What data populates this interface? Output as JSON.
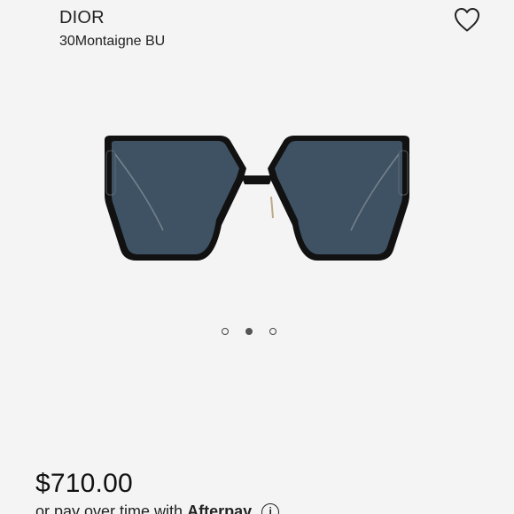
{
  "product": {
    "brand": "DIOR",
    "model": "30Montaigne BU",
    "price": "$710.00"
  },
  "favorite": {
    "icon": "heart-outline-icon"
  },
  "gallery": {
    "image_count": 3,
    "active_index": 1
  },
  "afterpay": {
    "prefix": "or pay over time with",
    "brand": "Afterpay",
    "info_icon_glyph": "i"
  },
  "colors": {
    "background": "#f4f4f4",
    "frame": "#111111",
    "lens": "#3f5263",
    "temple": "#bba98a"
  }
}
